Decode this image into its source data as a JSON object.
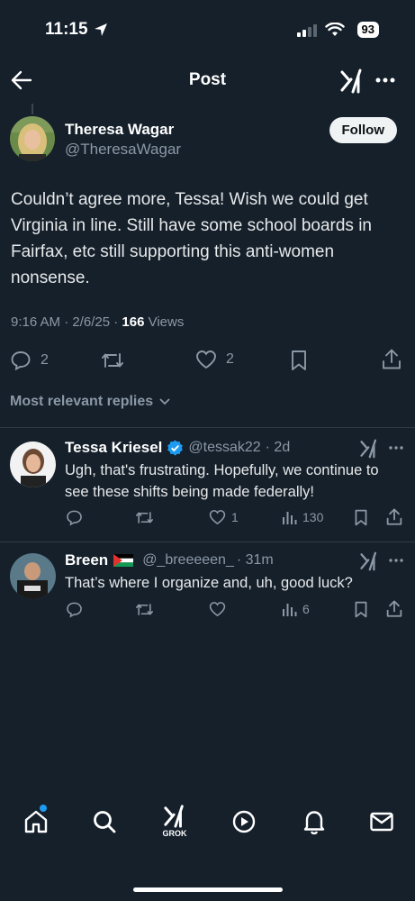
{
  "status": {
    "time": "11:15",
    "battery": "93"
  },
  "header": {
    "title": "Post",
    "grok_icon": "grok-icon",
    "more_icon": "more-icon"
  },
  "post": {
    "author_name": "Theresa Wagar",
    "author_handle": "@TheresaWagar",
    "follow_label": "Follow",
    "text": "Couldn’t agree more, Tessa!  Wish we could get Virginia in line. Still have some school boards in Fairfax, etc still supporting this anti-women nonsense.",
    "time_date": "9:16 AM · 2/6/25 · ",
    "views_count": "166",
    "views_label": " Views",
    "reply_count": "2",
    "like_count": "2"
  },
  "replies_filter": "Most relevant replies",
  "replies": [
    {
      "name": "Tessa Kriesel",
      "verified": true,
      "handle": "@tessak22",
      "time": "· 2d",
      "text": "Ugh, that's frustrating. Hopefully, we continue to see these shifts being made federally!",
      "likes": "1",
      "views": "130"
    },
    {
      "name": "Breen",
      "flag": "🇵🇸",
      "handle": "@_breeeeen_",
      "time": "· 31m",
      "text": "That’s where I organize and, uh, good luck?",
      "likes": "",
      "views": "6"
    }
  ],
  "tabbar": {
    "grok_label": "GROK"
  },
  "colors": {
    "background": "#15202b",
    "accent": "#1d9bf0",
    "text": "#e7e9ea",
    "muted": "#8b98a5"
  }
}
